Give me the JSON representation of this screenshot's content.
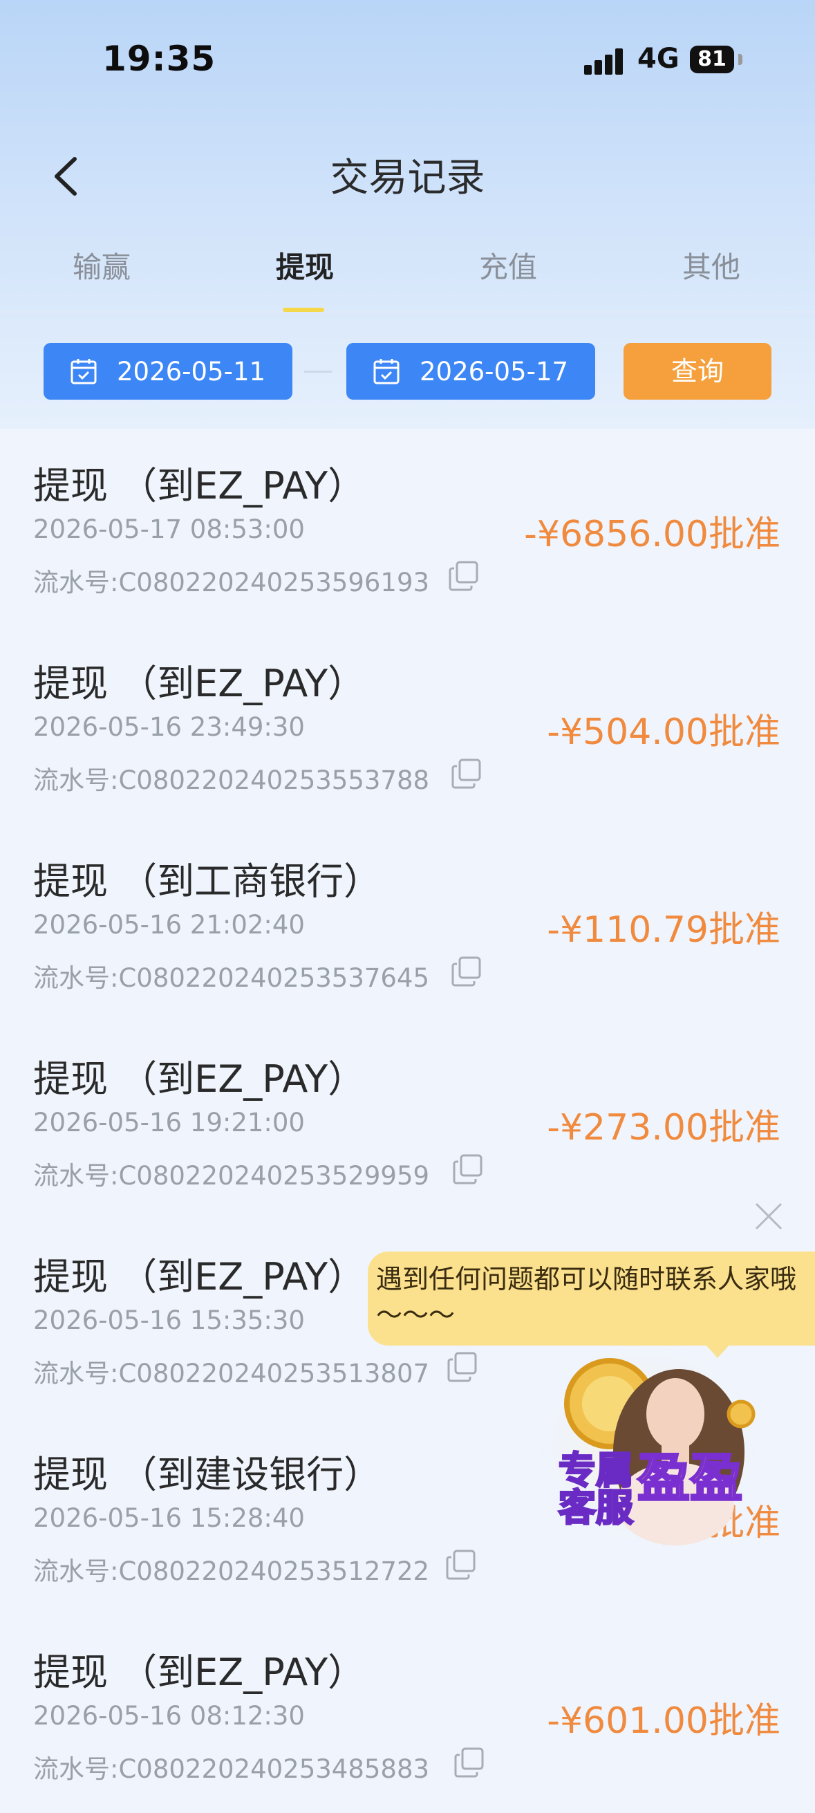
{
  "status_bar": {
    "time": "19:35",
    "network": "4G",
    "battery": "81"
  },
  "nav": {
    "title": "交易记录"
  },
  "tabs": [
    {
      "label": "输赢"
    },
    {
      "label": "提现"
    },
    {
      "label": "充值"
    },
    {
      "label": "其他"
    }
  ],
  "active_tab": "提现",
  "filters": {
    "start_date": "2026-05-11",
    "end_date": "2026-05-17",
    "query_label": "查询"
  },
  "transactions": [
    {
      "title": "提现 （到EZ_PAY）",
      "time": "2026-05-17 08:53:00",
      "serial": "流水号:C080220240253596193",
      "amount": "-¥6856.00批准"
    },
    {
      "title": "提现 （到EZ_PAY）",
      "time": "2026-05-16 23:49:30",
      "serial": "流水号:C080220240253553788",
      "amount": "-¥504.00批准"
    },
    {
      "title": "提现 （到工商银行）",
      "time": "2026-05-16 21:02:40",
      "serial": "流水号:C080220240253537645",
      "amount": "-¥110.79批准"
    },
    {
      "title": "提现 （到EZ_PAY）",
      "time": "2026-05-16 19:21:00",
      "serial": "流水号:C080220240253529959",
      "amount": "-¥273.00批准"
    },
    {
      "title": "提现 （到EZ_PAY）",
      "time": "2026-05-16 15:35:30",
      "serial": "流水号:C080220240253513807",
      "amount": ""
    },
    {
      "title": "提现 （到建设银行）",
      "time": "2026-05-16 15:28:40",
      "serial": "流水号:C080220240253512722",
      "amount": "批准"
    },
    {
      "title": "提现 （到EZ_PAY）",
      "time": "2026-05-16 08:12:30",
      "serial": "流水号:C080220240253485883",
      "amount": "-¥601.00批准"
    }
  ],
  "customer_service": {
    "bubble_text": "遇到任何问题都可以随时联系人家哦～～～",
    "badge_line1": "专属",
    "badge_line2": "客服",
    "badge_name": "盈盈"
  },
  "colors": {
    "accent_blue": "#3d86f5",
    "query_orange": "#f5a03c",
    "amount_orange": "#f08a3e",
    "tab_indicator": "#f5d84a"
  }
}
